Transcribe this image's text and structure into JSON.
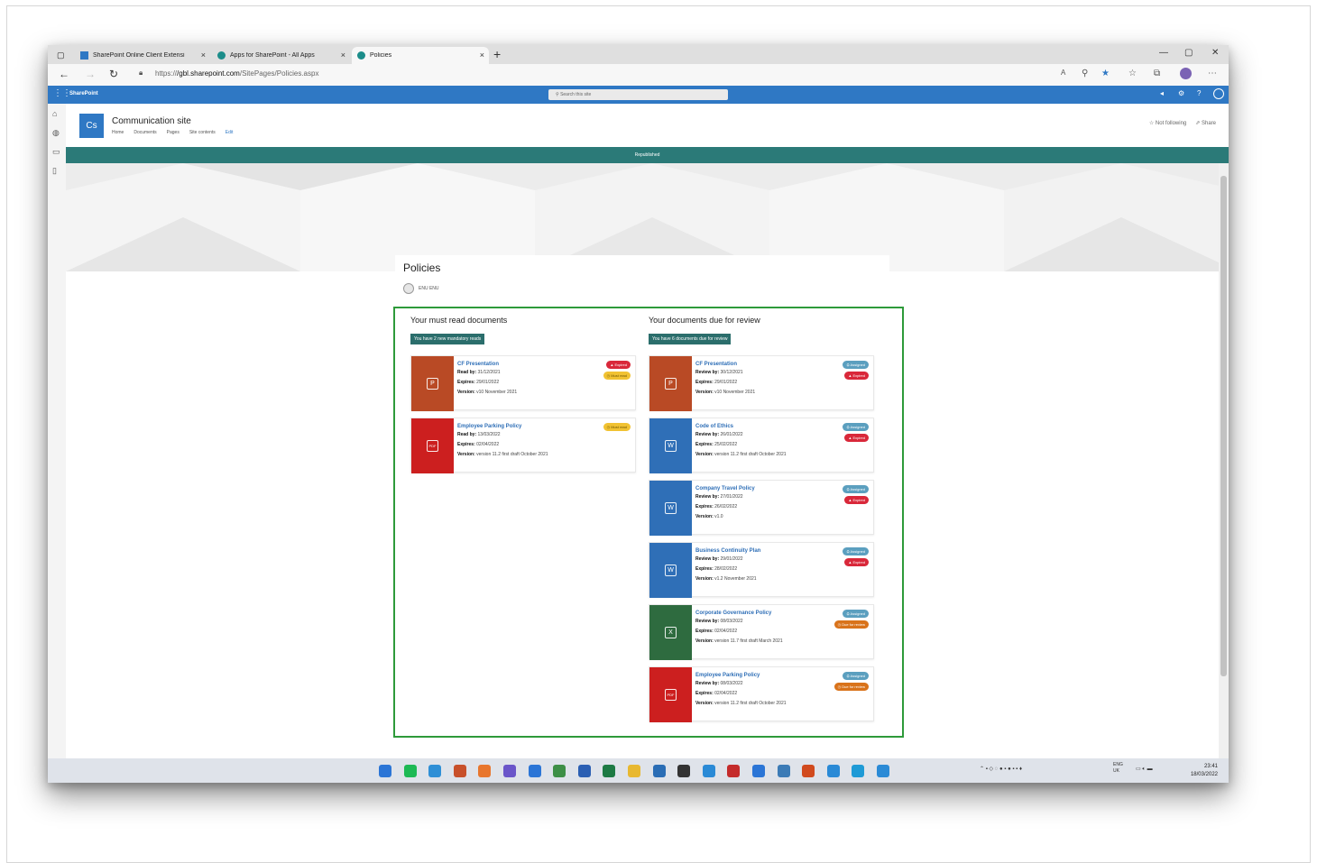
{
  "browser": {
    "tabs": [
      {
        "label": "SharePoint Online Client Extensi",
        "icon": "sharepoint-icon"
      },
      {
        "label": "Apps for SharePoint - All Apps",
        "icon": "sharepoint-icon"
      },
      {
        "label": "Policies",
        "icon": "sharepoint-icon"
      }
    ],
    "url_prefix": "https://",
    "url_host": "/gbl.sharepoint.com",
    "url_path": "/SitePages/Policies.aspx"
  },
  "suite": {
    "brand": "SharePoint",
    "search_placeholder": "Search this site"
  },
  "site": {
    "logo_initials": "Cs",
    "title": "Communication site",
    "nav": [
      "Home",
      "Documents",
      "Pages",
      "Site contents",
      "Edit"
    ],
    "not_following": "Not following",
    "share": "Share",
    "published_banner": "Republished"
  },
  "page": {
    "title": "Policies",
    "author": "ENU ENU"
  },
  "must_read": {
    "heading": "Your must read documents",
    "pill": "You have 2 new mandatory reads",
    "cards": [
      {
        "title": "CF Presentation",
        "date_label": "Read by:",
        "date": "31/12/2021",
        "expires": "29/01/2022",
        "version": "v10 November 2021",
        "badges": [
          "Expired",
          "Must read"
        ],
        "tile": "powerpoint",
        "color": "#b94a25"
      },
      {
        "title": "Employee Parking Policy",
        "date_label": "Read by:",
        "date": "13/03/2022",
        "expires": "02/04/2022",
        "version": "version 11.2 first draft October 2021",
        "badges": [
          "Must read"
        ],
        "tile": "pdf",
        "color": "#cc1f1f"
      }
    ]
  },
  "review": {
    "heading": "Your documents due for review",
    "pill": "You have 6 documents due for review",
    "cards": [
      {
        "title": "CF Presentation",
        "date_label": "Review by:",
        "date": "30/12/2021",
        "expires": "29/01/2022",
        "version": "v10 November 2021",
        "badges": [
          "Assigned",
          "Expired"
        ],
        "tile": "powerpoint",
        "color": "#b94a25"
      },
      {
        "title": "Code of Ethics",
        "date_label": "Review by:",
        "date": "26/01/2022",
        "expires": "25/02/2022",
        "version": "version 11.2 first draft October 2021",
        "badges": [
          "Assigned",
          "Expired"
        ],
        "tile": "word",
        "color": "#2f6fb7"
      },
      {
        "title": "Company Travel Policy",
        "date_label": "Review by:",
        "date": "27/01/2022",
        "expires": "26/02/2022",
        "version": "v1.0",
        "badges": [
          "Assigned",
          "Expired"
        ],
        "tile": "word",
        "color": "#2f6fb7"
      },
      {
        "title": "Business Continuity Plan",
        "date_label": "Review by:",
        "date": "29/01/2022",
        "expires": "28/02/2022",
        "version": "v1.2 November 2021",
        "badges": [
          "Assigned",
          "Expired"
        ],
        "tile": "word",
        "color": "#2f6fb7"
      },
      {
        "title": "Corporate Governance Policy",
        "date_label": "Review by:",
        "date": "08/03/2022",
        "expires": "02/04/2022",
        "version": "version 11.7 first draft March 2021",
        "badges": [
          "Assigned",
          "Due for review"
        ],
        "tile": "excel",
        "color": "#2e6b3f"
      },
      {
        "title": "Employee Parking Policy",
        "date_label": "Review by:",
        "date": "08/03/2022",
        "expires": "02/04/2022",
        "version": "version 11.2 first draft October 2021",
        "badges": [
          "Assigned",
          "Due for review"
        ],
        "tile": "pdf",
        "color": "#cc1f1f"
      }
    ]
  },
  "labels": {
    "expires": "Expires:",
    "version": "Version:"
  },
  "taskbar": {
    "lang": "ENG",
    "region": "UK",
    "time": "23:41",
    "date": "18/03/2022"
  }
}
